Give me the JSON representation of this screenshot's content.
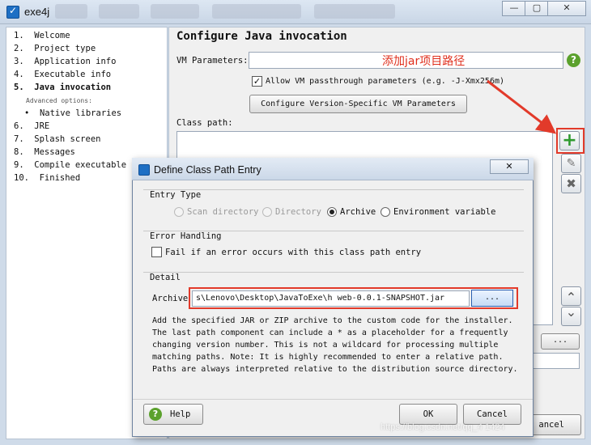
{
  "window": {
    "title": "exe4j",
    "controls": {
      "minimize": "—",
      "maximize": "▢",
      "close": "✕"
    }
  },
  "nav": {
    "steps": [
      {
        "label": "1.  Welcome",
        "active": false
      },
      {
        "label": "2.  Project type",
        "active": false
      },
      {
        "label": "3.  Application info",
        "active": false
      },
      {
        "label": "4.  Executable info",
        "active": false
      },
      {
        "label": "5.  Java invocation",
        "active": true
      },
      {
        "label": "Advanced options:",
        "active": false
      },
      {
        "label": "•  Native libraries",
        "active": false
      },
      {
        "label": "6.  JRE",
        "active": false
      },
      {
        "label": "7.  Splash screen",
        "active": false
      },
      {
        "label": "8.  Messages",
        "active": false
      },
      {
        "label": "9.  Compile executable",
        "active": false
      },
      {
        "label": "10.  Finished",
        "active": false
      }
    ]
  },
  "main": {
    "title": "Configure Java invocation",
    "vm_label": "VM Parameters:",
    "vm_value": "",
    "annotation": "添加jar项目路径",
    "allow_label": "Allow VM passthrough parameters (e.g. -J-Xmx256m)",
    "allow_checked": "✓",
    "config_button": "Configure Version-Specific VM Parameters",
    "classpath_label": "Class path:",
    "side_buttons": {
      "add": "+",
      "edit": "✎",
      "remove": "✖",
      "up": "⌃",
      "down": "⌄"
    },
    "browse_small": "...",
    "cancel_partial": "ancel"
  },
  "dialog": {
    "title": "Define Class Path Entry",
    "close": "✕",
    "entry_type": {
      "label": "Entry Type",
      "options": [
        {
          "label": "Scan directory",
          "enabled": false,
          "selected": false
        },
        {
          "label": "Directory",
          "enabled": false,
          "selected": false
        },
        {
          "label": "Archive",
          "enabled": true,
          "selected": true
        },
        {
          "label": "Environment variable",
          "enabled": true,
          "selected": false
        }
      ]
    },
    "error_handling": {
      "label": "Error Handling",
      "fail_label": "Fail if an error occurs with this class path entry",
      "fail_checked": false
    },
    "detail": {
      "label": "Detail",
      "archive_label": "Archive",
      "archive_value": "s\\Lenovo\\Desktop\\JavaToExe\\h     web-0.0.1-SNAPSHOT.jar",
      "browse_label": "...",
      "description": "Add the specified JAR or ZIP archive to the custom code for the installer. The last path component can include a * as a placeholder for a frequently changing version number. This is not a wildcard for processing multiple matching paths. Note: It is highly recommended to enter a relative path. Paths are always interpreted relative to the distribution source directory."
    },
    "buttons": {
      "help": "Help",
      "help_icon": "?",
      "ok": "OK",
      "cancel": "Cancel"
    }
  },
  "watermark": "https://blog.csdn.net/qq_4    1424",
  "colors": {
    "annotation": "#e0301e",
    "highlight": "#e23a2a",
    "add_icon": "#2f9a2f",
    "help_icon": "#5ba12c"
  }
}
